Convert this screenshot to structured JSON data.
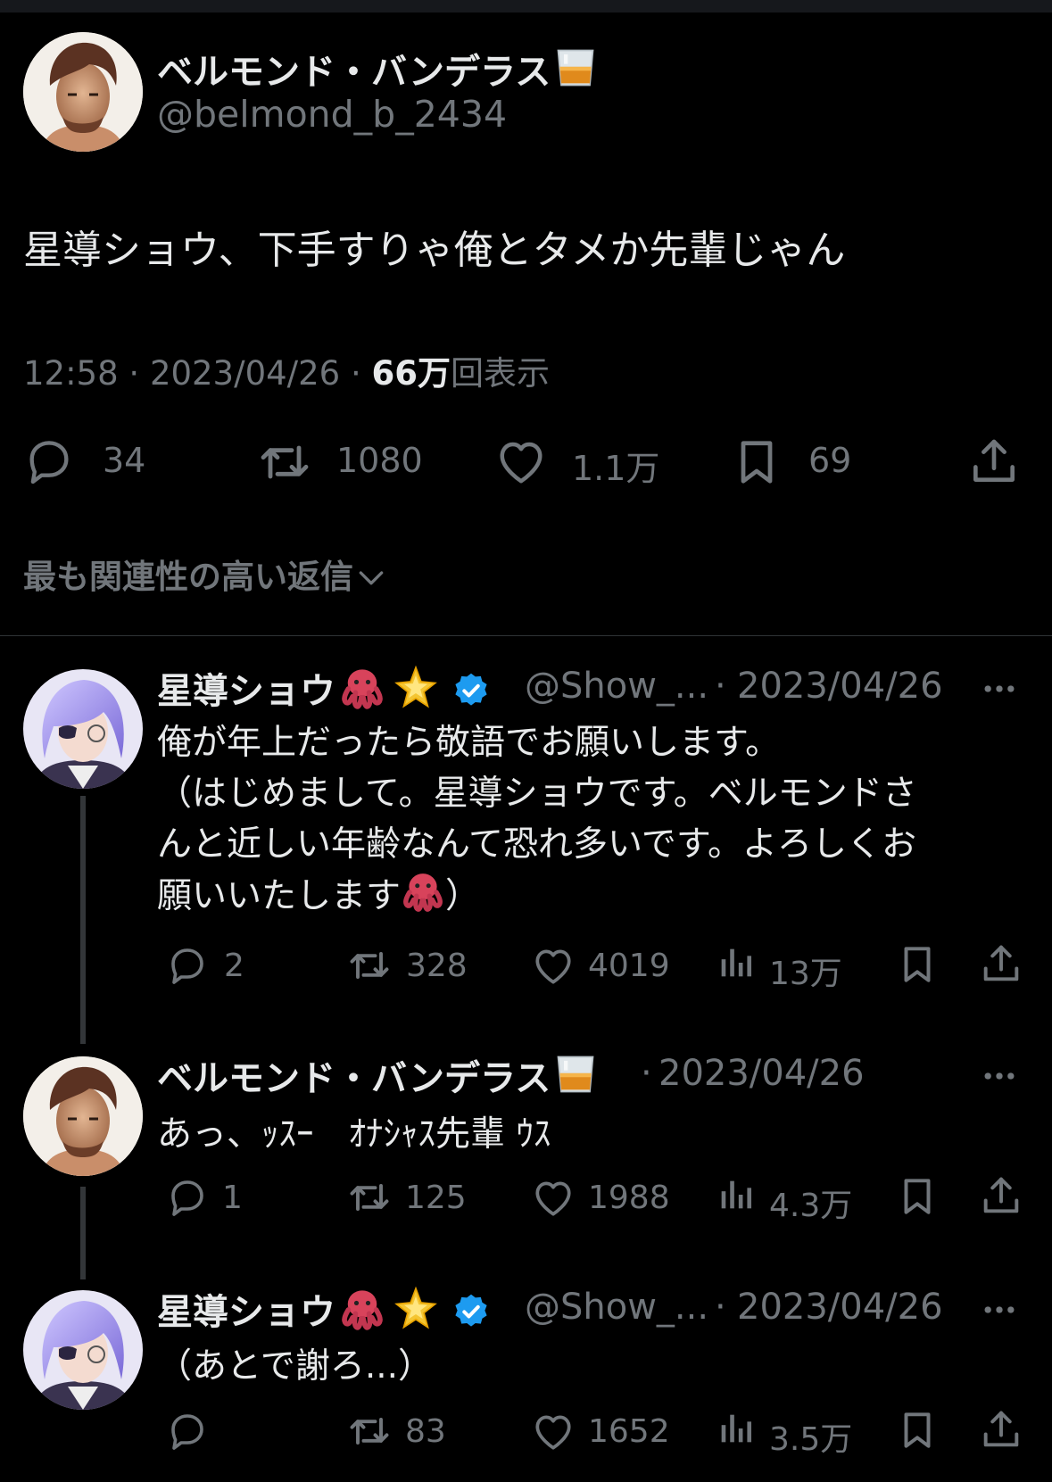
{
  "main_tweet": {
    "author_name": "ベルモンド・バンデラス",
    "author_handle": "@belmond_b_2434",
    "text": "星導ショウ、下手すりゃ俺とタメか先輩じゃん",
    "time": "12:58",
    "date": "2023/04/26",
    "views_number": "66万",
    "views_label": "回表示",
    "stats": {
      "replies": "34",
      "retweets": "1080",
      "likes": "1.1万",
      "bookmarks": "69"
    }
  },
  "sort_label": "最も関連性の高い返信",
  "replies": [
    {
      "author_name": "星導ショウ",
      "author_handle": "@Show_...",
      "date": "2023/04/26",
      "text_lines": [
        "俺が年上だったら敬語でお願いします。",
        "（はじめまして。星導ショウです。ベルモンドさ",
        "んと近しい年齢なんて恐れ多いです。よろしくお",
        "願いいたします"
      ],
      "text_tail": "）",
      "stats": {
        "replies": "2",
        "retweets": "328",
        "likes": "4019",
        "views": "13万"
      }
    },
    {
      "author_name": "ベルモンド・バンデラス",
      "date": "2023/04/26",
      "text": "あっ、ｯｽｰ　ｵﾅｼｬｽ先輩 ｳｽ",
      "stats": {
        "replies": "1",
        "retweets": "125",
        "likes": "1988",
        "views": "4.3万"
      }
    },
    {
      "author_name": "星導ショウ",
      "author_handle": "@Show_...",
      "date": "2023/04/26",
      "text": "（あとで謝ろ...）",
      "stats": {
        "replies": "",
        "retweets": "83",
        "likes": "1652",
        "views": "3.5万"
      }
    }
  ],
  "separator": "·",
  "icons": [
    "whisky-glass-icon",
    "octopus-icon",
    "sparkle-star-icon",
    "verified-badge-icon",
    "reply-icon",
    "retweet-icon",
    "like-icon",
    "bookmark-icon",
    "share-icon",
    "views-icon",
    "more-icon",
    "chevron-down-icon"
  ],
  "colors": {
    "background": "#000000",
    "text": "#e7e9ea",
    "secondary": "#71767b",
    "verified": "#1d9bf0",
    "divider": "#2f3336"
  }
}
